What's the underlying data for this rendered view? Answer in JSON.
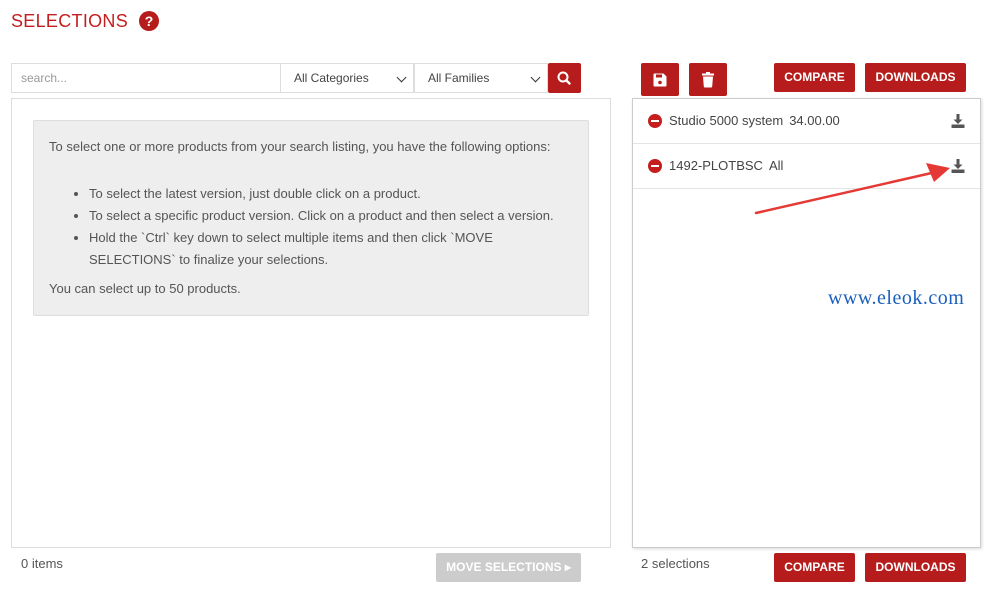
{
  "header": {
    "title": "SELECTIONS",
    "help_icon": "question-circle-icon"
  },
  "search": {
    "placeholder": "search...",
    "categories": "All Categories",
    "families": "All Families"
  },
  "info": {
    "intro": "To select one or more products from your search listing, you have the following options:",
    "options": [
      "To select the latest version, just double click on a product.",
      "To select a specific product version. Click on a product and then select a version.",
      "Hold the `Ctrl` key down to select multiple items and then click `MOVE SELECTIONS` to finalize your selections."
    ],
    "limit": "You can select up to 50 products."
  },
  "left_footer": {
    "count": "0 items",
    "move_label": "MOVE SELECTIONS ▸"
  },
  "toolbar": {
    "compare_label": "COMPARE",
    "downloads_label": "DOWNLOADS"
  },
  "selections": [
    {
      "name": "Studio 5000 system",
      "version": "34.00.00"
    },
    {
      "name": "1492-PLOTBSC",
      "version": "All"
    }
  ],
  "right_footer": {
    "count": "2 selections",
    "compare_label": "COMPARE",
    "downloads_label": "DOWNLOADS"
  },
  "watermark": "www.eleok.com",
  "colors": {
    "brand_red": "#b71c1c",
    "title_red": "#c41e1e",
    "disabled_gray": "#cccccc",
    "watermark_blue": "#1a5fbf"
  }
}
